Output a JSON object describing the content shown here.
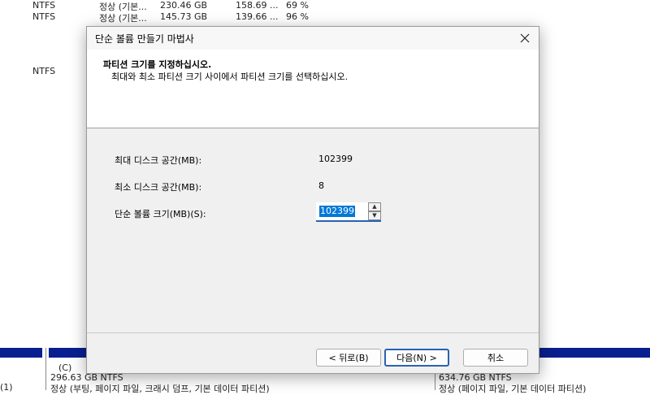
{
  "background": {
    "rows": [
      {
        "fs": "NTFS",
        "status": "정상 (기본...",
        "capacity": "230.46 GB",
        "free": "158.69 ...",
        "pct": "69 %"
      },
      {
        "fs": "NTFS",
        "status": "정상 (기본...",
        "capacity": "145.73 GB",
        "free": "139.66 ...",
        "pct": "96 %"
      },
      {
        "fs": "NTFS",
        "status": "",
        "capacity": "",
        "free": "",
        "pct": ""
      }
    ],
    "bottom": {
      "left_fragment": "(1)",
      "c_label": "(C)",
      "c_size": "296.63 GB NTFS",
      "c_status": "정상 (부팅, 페이지 파일, 크래시 덤프, 기본 데이터 파티션)",
      "right_size": "634.76 GB NTFS",
      "right_status": "정상 (페이지 파일, 기본 데이터 파티션)"
    }
  },
  "dialog": {
    "title": "단순 볼륨 만들기 마법사",
    "heading": "파티션 크기를 지정하십시오.",
    "subheading": "최대와 최소 파티션 크기 사이에서 파티션 크기를 선택하십시오.",
    "fields": {
      "max_label": "최대 디스크 공간(MB):",
      "max_value": "102399",
      "min_label": "최소 디스크 공간(MB):",
      "min_value": "8",
      "size_label": "단순 볼륨 크기(MB)(S):",
      "size_value": "102399"
    },
    "buttons": {
      "back": "< 뒤로(B)",
      "next": "다음(N) >",
      "cancel": "취소"
    }
  }
}
